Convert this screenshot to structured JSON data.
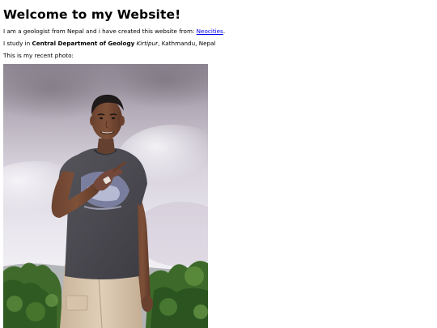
{
  "heading": "Welcome to my Website!",
  "intro": {
    "text": "I am a geologist from Nepal and i have created this website from: ",
    "link_label": "Neocities",
    "suffix": "."
  },
  "study": {
    "prefix": "I study in ",
    "department": "Central Department of Geology",
    "campus": "Kirtipur",
    "location": ", Kathmandu, Nepal"
  },
  "photo_caption": "This is my recent photo:",
  "colors": {
    "link": "#0000ee",
    "text": "#000000",
    "background": "#ffffff"
  },
  "icons": {
    "photo": "profile-photo"
  }
}
